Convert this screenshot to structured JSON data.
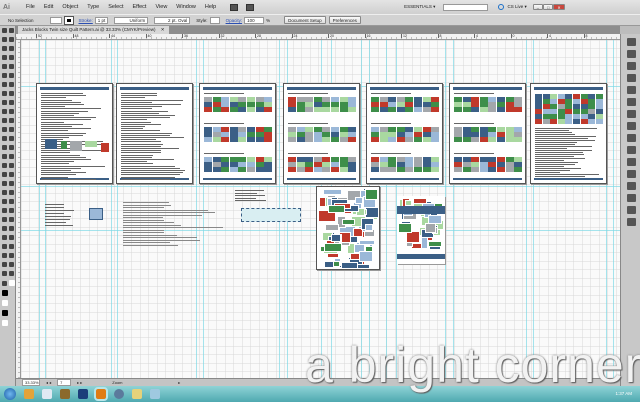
{
  "app": {
    "logo": "Ai",
    "menu": [
      "File",
      "Edit",
      "Object",
      "Type",
      "Select",
      "Effect",
      "View",
      "Window",
      "Help"
    ],
    "workspace": "ESSENTIALS ▾",
    "search_placeholder": "",
    "cs_live": "CS Live ▾",
    "window_controls": [
      "–",
      "□",
      "✕"
    ]
  },
  "control": {
    "selection": "No Selection",
    "stroke_label": "Stroke:",
    "stroke_value": "1 pt",
    "profile": "Uniform",
    "brush": "2 pt. Oval",
    "style_label": "Style:",
    "opacity_label": "Opacity:",
    "opacity_value": "100",
    "opacity_unit": "%",
    "document_setup": "Document Setup",
    "preferences": "Preferences"
  },
  "document": {
    "tab_title": "Jacks Blocks Twin size Quilt Pattern.ai @ 33.33% (CMYK/Preview)",
    "close": "✕"
  },
  "ruler": {
    "ticks": [
      "52",
      "48",
      "44",
      "40",
      "36",
      "32",
      "28",
      "24",
      "20",
      "16",
      "12",
      "8",
      "4",
      "0",
      "4",
      "8"
    ]
  },
  "status": {
    "zoom": "33.33%",
    "artboard": "7",
    "tool": "Zoom"
  },
  "taskbar": {
    "clock": "1:37 AM"
  },
  "watermark": "a bright corner",
  "colors": {
    "blue": "#3b5f86",
    "red": "#c0392b",
    "green": "#3e8e4a",
    "gray": "#a3a7ab",
    "lightblue": "#9bb8d8",
    "lightgreen": "#a9d8a0"
  }
}
